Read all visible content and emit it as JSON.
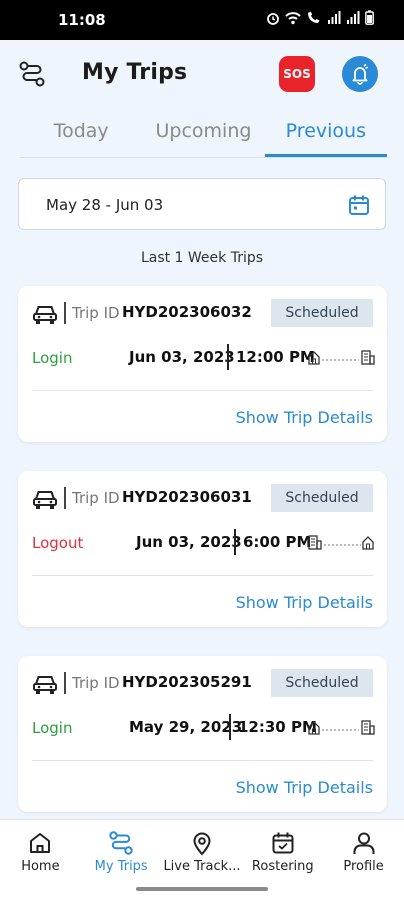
{
  "status_bar": {
    "time": "11:08",
    "icons": [
      "alarm-icon",
      "wifi-icon",
      "volte-icon",
      "signal-icon",
      "signal-icon",
      "battery-icon"
    ]
  },
  "header": {
    "title": "My Trips",
    "route_icon": "route-icon",
    "sos_label": "SOS",
    "bell_icon": "bell-icon"
  },
  "tabs": [
    {
      "label": "Today",
      "active": false
    },
    {
      "label": "Upcoming",
      "active": false
    },
    {
      "label": "Previous",
      "active": true
    }
  ],
  "date_range": {
    "value": "May 28 - Jun 03",
    "icon": "calendar-icon"
  },
  "subtitle": "Last 1 Week Trips",
  "trips": [
    {
      "trip_id_label": "Trip ID",
      "trip_id": "HYD202306032",
      "status": "Scheduled",
      "type": "Login",
      "date": "Jun 03, 2023",
      "time": "12:00 PM",
      "details_label": "Show Trip Details"
    },
    {
      "trip_id_label": "Trip ID",
      "trip_id": "HYD202306031",
      "status": "Scheduled",
      "type": "Logout",
      "date": "Jun 03, 2023",
      "time": "6:00 PM",
      "details_label": "Show Trip Details"
    },
    {
      "trip_id_label": "Trip ID",
      "trip_id": "HYD202305291",
      "status": "Scheduled",
      "type": "Login",
      "date": "May 29, 2023",
      "time": "12:30 PM",
      "details_label": "Show Trip Details"
    }
  ],
  "bottom_nav": [
    {
      "label": "Home",
      "icon": "home-icon",
      "active": false
    },
    {
      "label": "My Trips",
      "icon": "route-icon",
      "active": true
    },
    {
      "label": "Live Track...",
      "icon": "location-pin-icon",
      "active": false
    },
    {
      "label": "Rostering",
      "icon": "calendar-icon",
      "active": false
    },
    {
      "label": "Profile",
      "icon": "person-icon",
      "active": false
    }
  ],
  "colors": {
    "accent": "#2a8ad6",
    "sos": "#e8232a",
    "login": "#2e9e3e",
    "logout": "#e0303a",
    "badge_bg": "#dde5ef",
    "page_bg": "#eef5fc"
  }
}
